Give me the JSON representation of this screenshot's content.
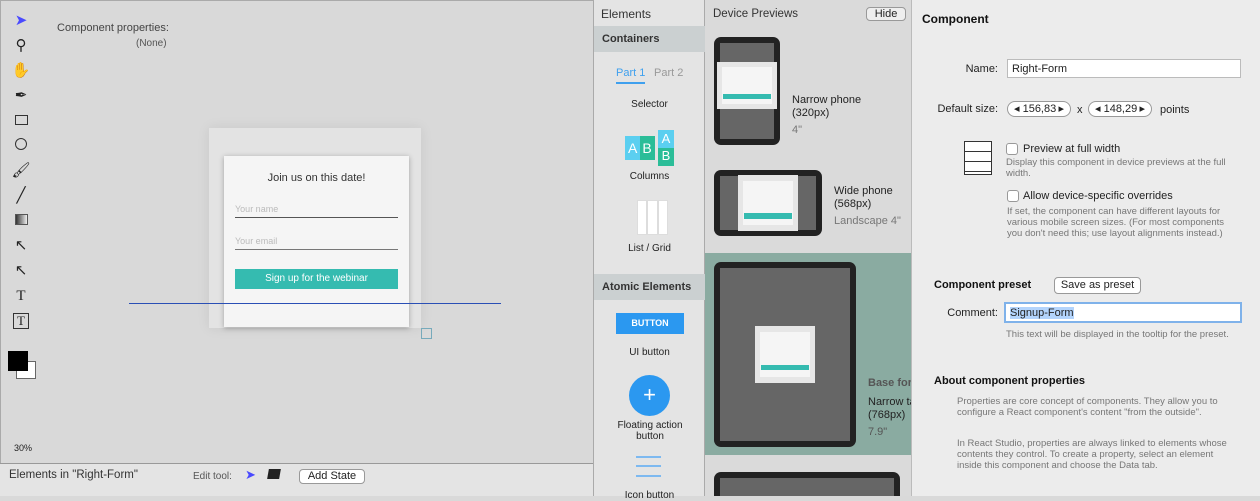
{
  "canvas": {
    "props_label": "Component properties:",
    "props_value": "(None)",
    "zoom": "30%",
    "form": {
      "title": "Join us on this date!",
      "name_placeholder": "Your name",
      "email_placeholder": "Your email",
      "submit": "Sign up for the webinar"
    }
  },
  "bottom": {
    "title": "Elements in \"Right-Form\"",
    "edit_tool": "Edit tool:",
    "add_state": "Add State"
  },
  "elements": {
    "title": "Elements",
    "containers": "Containers",
    "tab1": "Part 1",
    "tab2": "Part 2",
    "selector": "Selector",
    "columns": "Columns",
    "list_grid": "List / Grid",
    "atomic": "Atomic Elements",
    "button_text": "BUTTON",
    "ui_button": "UI button",
    "fab_label": "Floating action button",
    "icon_button": "Icon button"
  },
  "previews": {
    "title": "Device Previews",
    "hide": "Hide",
    "devices": [
      {
        "name": "Narrow phone",
        "px": "(320px)",
        "size": "4\""
      },
      {
        "name": "Wide phone",
        "px": "(568px)",
        "size": "Landscape 4\""
      },
      {
        "base": "Base for",
        "name": "Narrow tablet",
        "px": "(768px)",
        "size": "7.9\""
      }
    ]
  },
  "component": {
    "title": "Component",
    "name_label": "Name:",
    "name_value": "Right-Form",
    "size_label": "Default size:",
    "width": "156,83",
    "height": "148,29",
    "x": "x",
    "units": "points",
    "preview_full": "Preview at full width",
    "preview_full_help": "Display this component in device previews at the full width.",
    "overrides": "Allow device-specific overrides",
    "overrides_help": "If set, the component can have different layouts for various mobile screen sizes. (For most components you don't need this; use layout alignments instead.)",
    "preset_title": "Component preset",
    "save_preset": "Save as preset",
    "comment_label": "Comment:",
    "comment_value": "Signup-Form",
    "comment_help": "This text will be displayed in the tooltip for the preset.",
    "about_title": "About component properties",
    "about_p1": "Properties are core concept of components. They allow you to configure a React component's content \"from the outside\".",
    "about_p2": "In React Studio, properties are always linked to elements whose contents they control. To create a property, select an element inside this component and choose the Data tab."
  },
  "colors": {
    "teal": "#35bbb0",
    "accent": "#2b98f0",
    "selected": "#8aaba1"
  }
}
